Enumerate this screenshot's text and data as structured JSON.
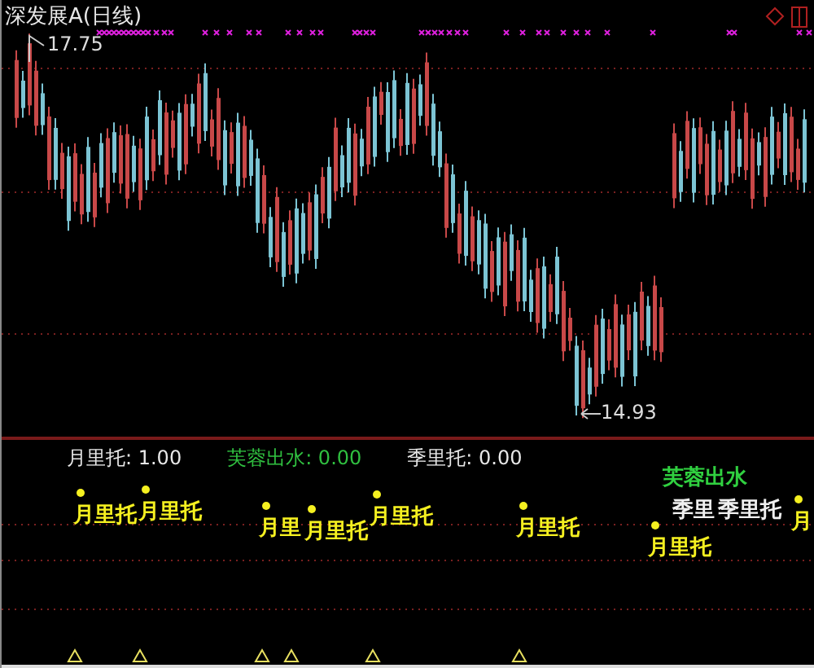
{
  "title": "深发展A(日线)",
  "price_labels": [
    {
      "kind": "high",
      "text": "17.75"
    },
    {
      "kind": "low",
      "text": "14.93"
    }
  ],
  "indicator_values": [
    {
      "kind": "month",
      "text": "月里托: 1.00"
    },
    {
      "kind": "lotus",
      "text": "芙蓉出水: 0.00"
    },
    {
      "kind": "season",
      "text": "季里托: 0.00"
    }
  ],
  "signals": [
    {
      "kind": "month",
      "text": "月里托"
    },
    {
      "kind": "month",
      "text": "月里托"
    },
    {
      "kind": "month",
      "text": "月里"
    },
    {
      "kind": "month",
      "text": "月里托"
    },
    {
      "kind": "month",
      "text": "月里托"
    },
    {
      "kind": "month",
      "text": "月里托"
    },
    {
      "kind": "lotus",
      "text": "芙蓉出水"
    },
    {
      "kind": "season",
      "text": "季里"
    },
    {
      "kind": "season",
      "text": "季里托"
    },
    {
      "kind": "month",
      "text": "月里托"
    },
    {
      "kind": "month",
      "text": "月"
    }
  ]
}
